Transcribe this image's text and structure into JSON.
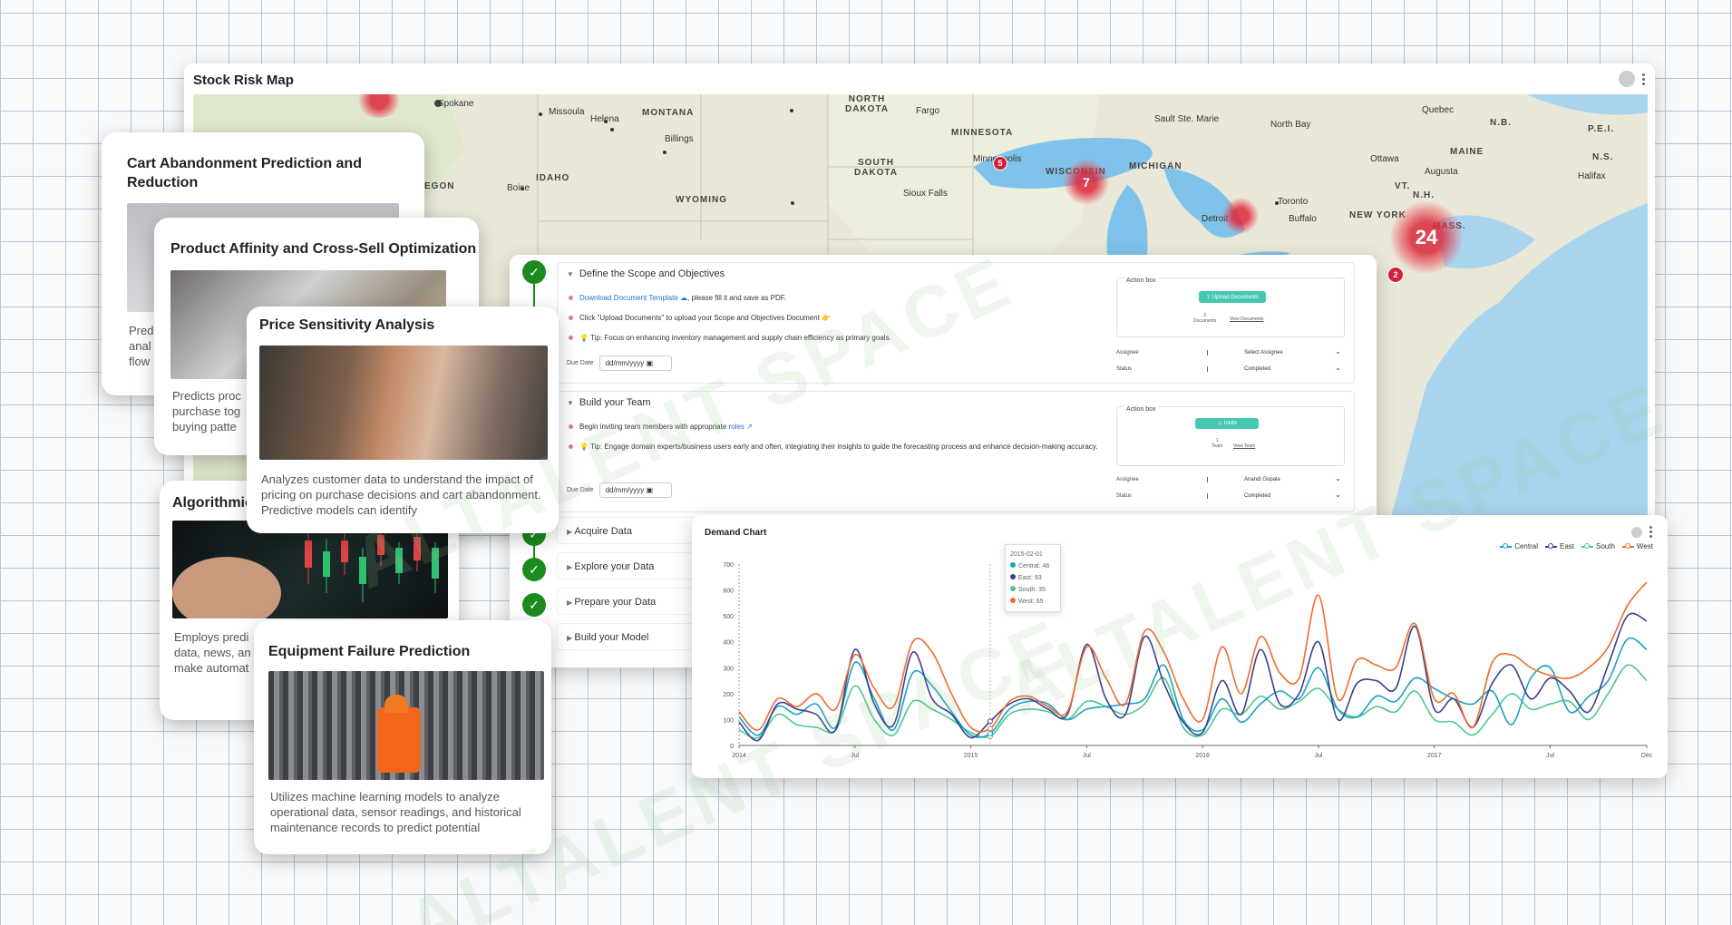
{
  "map": {
    "title": "Stock Risk Map",
    "filter_icon": "filter-icon",
    "menu_icon": "kebab-menu-icon",
    "states": [
      "NORTH DAKOTA",
      "MONTANA",
      "MINNESOTA",
      "SOUTH DAKOTA",
      "WISCONSIN",
      "MICHIGAN",
      "IDAHO",
      "WYOMING",
      "MAINE",
      "VT.",
      "N.H.",
      "MASS.",
      "NEW YORK",
      "N.B.",
      "P.E.I.",
      "N.S.",
      "EGON"
    ],
    "cities": [
      "Spokane",
      "Missoula",
      "Helena",
      "Billings",
      "Fargo",
      "Minneapolis",
      "Sioux Falls",
      "Boise",
      "Sault Ste. Marie",
      "North Bay",
      "Quebec",
      "Ottawa",
      "Augusta",
      "Halifax",
      "Toronto",
      "Buffalo",
      "Detroit"
    ],
    "clusters": [
      "24",
      "7",
      "5",
      "2"
    ]
  },
  "workflow": {
    "step1": {
      "title": "Define the Scope and Objectives",
      "bullet1_link": "Download Document Template",
      "bullet1_text": ", please fill it and save as PDF.",
      "bullet2": "Click \"Upload Documents\" to upload your Scope and Objectives Document 👉",
      "bullet3": "💡 Tip: Focus on enhancing inventory management and supply chain efficiency as primary goals.",
      "due_label": "Due Date",
      "due_value": "dd/mm/yyyy",
      "action_label": "Action box",
      "button": "Upload Documents",
      "count": "2",
      "count_label": "Documents",
      "view": "View Documents",
      "assignee_label": "Assignee",
      "assignee_value": "Select Assignee",
      "status_label": "Status",
      "status_value": "Completed"
    },
    "step2": {
      "title": "Build your Team",
      "bullet1_text": "Begin inviting team members with appropriate",
      "bullet1_link": "roles",
      "bullet2": "💡 Tip: Engage domain experts/business users early and often, integrating their insights to guide the forecasting process and enhance decision-making accuracy.",
      "due_label": "Due Date",
      "due_value": "dd/mm/yyyy",
      "action_label": "Action box",
      "button": "Invite",
      "count": "1",
      "count_label": "Team",
      "view": "View Team",
      "assignee_label": "Assignee",
      "assignee_value": "Anandi Gopala",
      "status_label": "Status",
      "status_value": "Completed"
    },
    "collapsed_steps": [
      "Acquire Data",
      "Explore your Data",
      "Prepare your Data",
      "Build your Model"
    ]
  },
  "cards": {
    "card1": {
      "title": "Cart Abandonment Prediction and Reduction",
      "desc": "Pred anal flow"
    },
    "card2": {
      "title": "Product Affinity and Cross-Sell Optimization",
      "desc": "Predicts proc purchase tog buying patte"
    },
    "card3": {
      "title": "Algorithmic",
      "desc": "Employs predi data, news, an make automat"
    },
    "card4": {
      "title": "Price Sensitivity Analysis",
      "desc": "Analyzes customer data to understand the impact of pricing on purchase decisions and cart abandonment. Predictive models can identify"
    },
    "card5": {
      "title": "Equipment Failure Prediction",
      "desc": "Utilizes machine learning models to analyze operational data, sensor readings, and historical maintenance records to predict potential"
    }
  },
  "chart": {
    "title": "Demand Chart",
    "tooltip": {
      "date": "2015-02-01",
      "central": "Central: 46",
      "east": "East: 93",
      "south": "South: 35",
      "west": "West: 65"
    }
  },
  "chart_data": {
    "type": "line",
    "title": "Demand Chart",
    "x": [
      "2014-01",
      "2014-02",
      "2014-03",
      "2014-04",
      "2014-05",
      "2014-06",
      "2014-07",
      "2014-08",
      "2014-09",
      "2014-10",
      "2014-11",
      "2014-12",
      "2015-01",
      "2015-02",
      "2015-03",
      "2015-04",
      "2015-05",
      "2015-06",
      "2015-07",
      "2015-08",
      "2015-09",
      "2015-10",
      "2015-11",
      "2015-12",
      "2016-01",
      "2016-02",
      "2016-03",
      "2016-04",
      "2016-05",
      "2016-06",
      "2016-07",
      "2016-08",
      "2016-09",
      "2016-10",
      "2016-11",
      "2016-12",
      "2017-01",
      "2017-02",
      "2017-03",
      "2017-04",
      "2017-05",
      "2017-06",
      "2017-07",
      "2017-08",
      "2017-09",
      "2017-10",
      "2017-11",
      "2017-12"
    ],
    "x_ticks": [
      "2014",
      "Jul",
      "2015",
      "Jul",
      "2016",
      "Jul",
      "2017",
      "Jul",
      "Dec"
    ],
    "y_ticks": [
      "0",
      "100",
      "200",
      "300",
      "400",
      "500",
      "600",
      "700"
    ],
    "ylim": [
      0,
      700
    ],
    "series": [
      {
        "name": "Central",
        "color": "#17a2c4",
        "values": [
          110,
          40,
          150,
          120,
          160,
          70,
          320,
          180,
          60,
          280,
          230,
          130,
          40,
          46,
          140,
          170,
          160,
          100,
          140,
          150,
          160,
          180,
          310,
          100,
          60,
          180,
          90,
          160,
          210,
          180,
          300,
          140,
          110,
          190,
          170,
          260,
          220,
          180,
          160,
          210,
          80,
          260,
          300,
          130,
          190,
          250,
          410,
          370
        ]
      },
      {
        "name": "East",
        "color": "#3a3f8c",
        "values": [
          90,
          20,
          160,
          140,
          120,
          60,
          370,
          160,
          80,
          360,
          180,
          120,
          30,
          93,
          160,
          180,
          140,
          120,
          390,
          180,
          120,
          420,
          240,
          90,
          50,
          250,
          120,
          370,
          160,
          200,
          400,
          100,
          240,
          250,
          220,
          460,
          140,
          180,
          70,
          240,
          310,
          180,
          260,
          210,
          130,
          310,
          500,
          480
        ]
      },
      {
        "name": "South",
        "color": "#4cc790",
        "values": [
          60,
          30,
          120,
          80,
          70,
          60,
          230,
          100,
          40,
          170,
          140,
          100,
          50,
          35,
          120,
          140,
          130,
          100,
          170,
          150,
          120,
          160,
          260,
          70,
          40,
          140,
          120,
          190,
          140,
          170,
          220,
          140,
          110,
          150,
          130,
          210,
          100,
          90,
          40,
          120,
          200,
          140,
          160,
          170,
          100,
          200,
          310,
          250
        ]
      },
      {
        "name": "West",
        "color": "#f26b2a",
        "values": [
          130,
          60,
          180,
          150,
          200,
          140,
          350,
          220,
          150,
          400,
          360,
          200,
          70,
          65,
          170,
          190,
          150,
          130,
          380,
          260,
          160,
          440,
          360,
          180,
          100,
          380,
          200,
          420,
          280,
          260,
          580,
          180,
          330,
          310,
          300,
          470,
          180,
          200,
          70,
          320,
          350,
          300,
          270,
          260,
          300,
          380,
          540,
          630
        ]
      }
    ]
  }
}
